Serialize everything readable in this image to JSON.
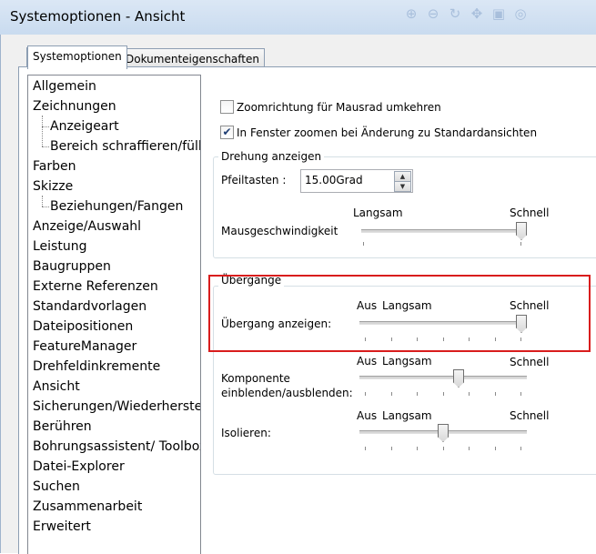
{
  "window": {
    "title": "Systemoptionen - Ansicht"
  },
  "tabs": [
    {
      "label": "Systemoptionen",
      "active": true
    },
    {
      "label": "Dokumenteigenschaften",
      "active": false
    }
  ],
  "tree": {
    "items": [
      {
        "label": "Allgemein",
        "level": 0
      },
      {
        "label": "Zeichnungen",
        "level": 0
      },
      {
        "label": "Anzeigeart",
        "level": 1
      },
      {
        "label": "Bereich schraffieren/fülle",
        "level": 1
      },
      {
        "label": "Farben",
        "level": 0
      },
      {
        "label": "Skizze",
        "level": 0
      },
      {
        "label": "Beziehungen/Fangen",
        "level": 1
      },
      {
        "label": "Anzeige/Auswahl",
        "level": 0
      },
      {
        "label": "Leistung",
        "level": 0
      },
      {
        "label": "Baugruppen",
        "level": 0
      },
      {
        "label": "Externe Referenzen",
        "level": 0
      },
      {
        "label": "Standardvorlagen",
        "level": 0
      },
      {
        "label": "Dateipositionen",
        "level": 0
      },
      {
        "label": "FeatureManager",
        "level": 0
      },
      {
        "label": "Drehfeldinkremente",
        "level": 0
      },
      {
        "label": "Ansicht",
        "level": 0,
        "selected": true
      },
      {
        "label": "Sicherungen/Wiederherstell",
        "level": 0
      },
      {
        "label": "Berühren",
        "level": 0
      },
      {
        "label": "Bohrungsassistent/ Toolbox",
        "level": 0
      },
      {
        "label": "Datei-Explorer",
        "level": 0
      },
      {
        "label": "Suchen",
        "level": 0
      },
      {
        "label": "Zusammenarbeit",
        "level": 0
      },
      {
        "label": "Erweitert",
        "level": 0
      }
    ]
  },
  "options": {
    "zoom_reverse": {
      "label": "Zoomrichtung für Mausrad umkehren",
      "checked": false
    },
    "zoom_fit": {
      "label": "In Fenster zoomen bei Änderung zu Standardansichten",
      "checked": true
    }
  },
  "rotation": {
    "caption": "Drehung anzeigen",
    "arrow_keys_label": "Pfeiltasten :",
    "arrow_keys_value": "15.00Grad",
    "mouse_speed_label": "Mausgeschwindigkeit",
    "slow_label": "Langsam",
    "fast_label": "Schnell",
    "mouse_speed_level": 1.0
  },
  "transitions": {
    "caption": "Übergänge",
    "off_label": "Aus",
    "slow_label": "Langsam",
    "fast_label": "Schnell",
    "show_transition": {
      "label": "Übergang anzeigen:",
      "level": 1.0
    },
    "component": {
      "label_line1": "Komponente",
      "label_line2": "einblenden/ausblenden:",
      "level": 0.6
    },
    "isolate": {
      "label": "Isolieren:",
      "level": 0.5
    }
  },
  "icons": {
    "title_toolbar": [
      "zoom-in-icon",
      "zoom-out-icon",
      "rotate-icon",
      "pan-icon",
      "view-icon",
      "filter-icon"
    ]
  },
  "highlight_color": "#d91d1d"
}
